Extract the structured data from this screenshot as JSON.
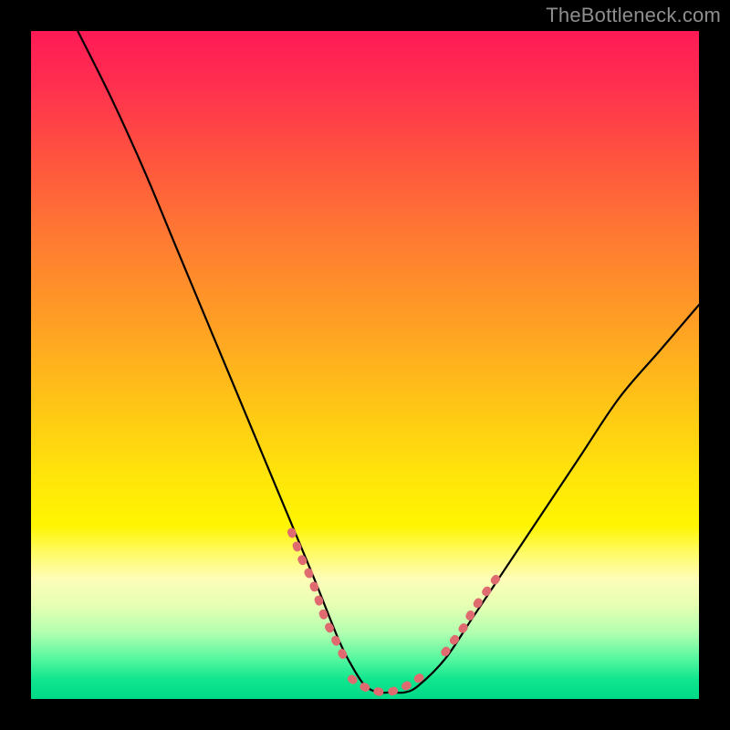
{
  "watermark": "TheBottleneck.com",
  "chart_data": {
    "type": "line",
    "title": "",
    "xlabel": "",
    "ylabel": "",
    "xlim": [
      0,
      100
    ],
    "ylim": [
      0,
      100
    ],
    "grid": false,
    "legend": false,
    "background_gradient": {
      "top": "#ff1a56",
      "mid1": "#ff9e25",
      "mid2": "#fff000",
      "bottom": "#00d988"
    },
    "series": [
      {
        "name": "bottleneck-curve",
        "color": "#000000",
        "style": "solid",
        "x": [
          7,
          12,
          17,
          22,
          27,
          32,
          37,
          42,
          46,
          48,
          50,
          52,
          54,
          56,
          58,
          62,
          66,
          70,
          76,
          82,
          88,
          94,
          100
        ],
        "y": [
          100,
          90,
          79,
          67,
          55,
          43,
          31,
          19,
          9,
          5,
          2,
          1,
          1,
          1,
          2,
          6,
          12,
          18,
          27,
          36,
          45,
          52,
          59
        ]
      },
      {
        "name": "marker-band-left",
        "color": "#e06d72",
        "style": "dotted-thick",
        "x": [
          39,
          40.5,
          42,
          43,
          44,
          45,
          46,
          47
        ],
        "y": [
          25,
          21,
          18,
          15,
          12,
          10,
          8,
          6
        ]
      },
      {
        "name": "marker-band-bottom",
        "color": "#e06d72",
        "style": "dotted-thick",
        "x": [
          48,
          49.5,
          51,
          52.5,
          54,
          55.5,
          57,
          58.5
        ],
        "y": [
          3,
          2,
          1.3,
          1,
          1.1,
          1.6,
          2.4,
          3.4
        ]
      },
      {
        "name": "marker-band-right",
        "color": "#e06d72",
        "style": "dotted-thick",
        "x": [
          62,
          63.5,
          65,
          66,
          67,
          68.5,
          70
        ],
        "y": [
          7,
          9,
          11,
          13,
          14.5,
          16.5,
          18.5
        ]
      }
    ]
  }
}
